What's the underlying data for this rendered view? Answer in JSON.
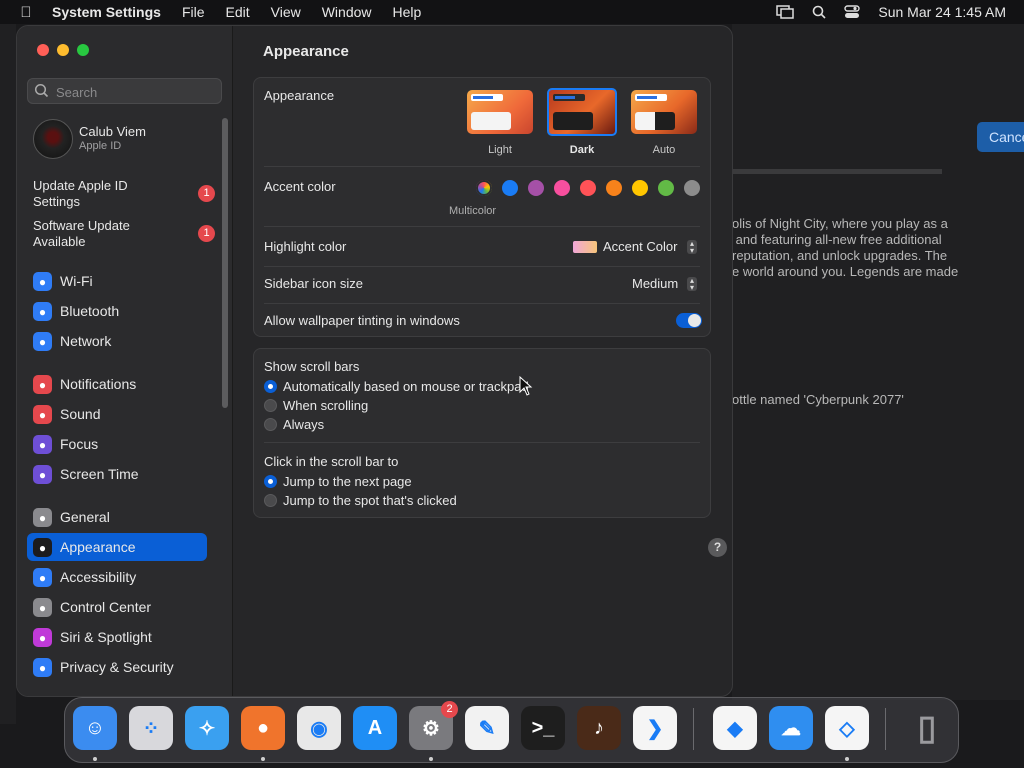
{
  "menubar": {
    "app_name": "System Settings",
    "menus": [
      "File",
      "Edit",
      "View",
      "Window",
      "Help"
    ],
    "datetime": "Sun Mar 24  1:45 AM"
  },
  "background_window": {
    "cancel_label": "Cance",
    "text_lines": [
      "olis of Night City, where you play as a",
      " and featuring all-new free additional",
      "reputation, and unlock upgrades. The",
      "e world around you. Legends are made"
    ],
    "text2": "ottle named 'Cyberpunk 2077'"
  },
  "sidebar": {
    "search_placeholder": "Search",
    "profile": {
      "name": "Calub Viem",
      "subtitle": "Apple ID"
    },
    "notices": [
      {
        "label": "Update Apple ID Settings",
        "badge": "1"
      },
      {
        "label": "Software Update Available",
        "badge": "1"
      }
    ],
    "items": [
      {
        "label": "Wi-Fi",
        "icon": "wifi-icon",
        "color": "#2f7cf6"
      },
      {
        "label": "Bluetooth",
        "icon": "bluetooth-icon",
        "color": "#2f7cf6"
      },
      {
        "label": "Network",
        "icon": "globe-icon",
        "color": "#2f7cf6"
      },
      {
        "label": "Notifications",
        "icon": "bell-icon",
        "color": "#e5484d"
      },
      {
        "label": "Sound",
        "icon": "speaker-icon",
        "color": "#e5484d"
      },
      {
        "label": "Focus",
        "icon": "moon-icon",
        "color": "#6e4fd6"
      },
      {
        "label": "Screen Time",
        "icon": "hourglass-icon",
        "color": "#6e4fd6"
      },
      {
        "label": "General",
        "icon": "gear-icon",
        "color": "#8a8a8e"
      },
      {
        "label": "Appearance",
        "icon": "appearance-icon",
        "color": "#1c1c1e"
      },
      {
        "label": "Accessibility",
        "icon": "accessibility-icon",
        "color": "#2f7cf6"
      },
      {
        "label": "Control Center",
        "icon": "switches-icon",
        "color": "#8a8a8e"
      },
      {
        "label": "Siri & Spotlight",
        "icon": "siri-icon",
        "color": "#c03ad8"
      },
      {
        "label": "Privacy & Security",
        "icon": "hand-icon",
        "color": "#2f7cf6"
      }
    ],
    "active_item": "Appearance"
  },
  "content": {
    "title": "Appearance",
    "appearance": {
      "label": "Appearance",
      "options": [
        "Light",
        "Dark",
        "Auto"
      ],
      "selected": "Dark"
    },
    "accent": {
      "label": "Accent color",
      "colors": [
        "multicolor",
        "#1a7cf5",
        "#a550a7",
        "#f74f9e",
        "#ff5257",
        "#f7821b",
        "#ffc600",
        "#62ba46",
        "#8c8c8c"
      ],
      "selected_label": "Multicolor"
    },
    "highlight": {
      "label": "Highlight color",
      "value": "Accent Color"
    },
    "sidebar_icon": {
      "label": "Sidebar icon size",
      "value": "Medium"
    },
    "tinting": {
      "label": "Allow wallpaper tinting in windows",
      "on": true
    },
    "scroll_bars": {
      "label": "Show scroll bars",
      "options": [
        "Automatically based on mouse or trackpad",
        "When scrolling",
        "Always"
      ],
      "selected_index": 0
    },
    "click_scroll": {
      "label": "Click in the scroll bar to",
      "options": [
        "Jump to the next page",
        "Jump to the spot that's clicked"
      ],
      "selected_index": 0
    },
    "help": "?"
  },
  "dock": {
    "apps": [
      {
        "name": "finder-icon",
        "glyph": "☺",
        "bg": "#3b8cf0"
      },
      {
        "name": "launchpad-icon",
        "glyph": "⁘",
        "bg": "#d8d8dc"
      },
      {
        "name": "safari-icon",
        "glyph": "✧",
        "bg": "#3aa0f0"
      },
      {
        "name": "firefox-icon",
        "glyph": "●",
        "bg": "#f0742c"
      },
      {
        "name": "chrome-icon",
        "glyph": "◉",
        "bg": "#e8e8e8"
      },
      {
        "name": "app-store-icon",
        "glyph": "A",
        "bg": "#1f8ef5"
      },
      {
        "name": "system-settings-icon",
        "glyph": "⚙",
        "bg": "#7a7a7e",
        "badge": "2"
      },
      {
        "name": "textedit-icon",
        "glyph": "✎",
        "bg": "#f2f2f2"
      },
      {
        "name": "terminal-icon",
        "glyph": ">_",
        "bg": "#1e1e1e"
      },
      {
        "name": "garageband-icon",
        "glyph": "♪",
        "bg": "#4a2a18"
      },
      {
        "name": "vscode-icon",
        "glyph": "❯",
        "bg": "#f5f5f5"
      },
      {
        "name": "visual-studio-icon",
        "glyph": "◆",
        "bg": "#f5f5f5"
      },
      {
        "name": "weather-icon",
        "glyph": "☁",
        "bg": "#2f8ef0"
      },
      {
        "name": "app-icon",
        "glyph": "◇",
        "bg": "#f5f5f5"
      },
      {
        "name": "trash-icon",
        "glyph": "▯",
        "bg": "#6a6a6e"
      }
    ]
  }
}
